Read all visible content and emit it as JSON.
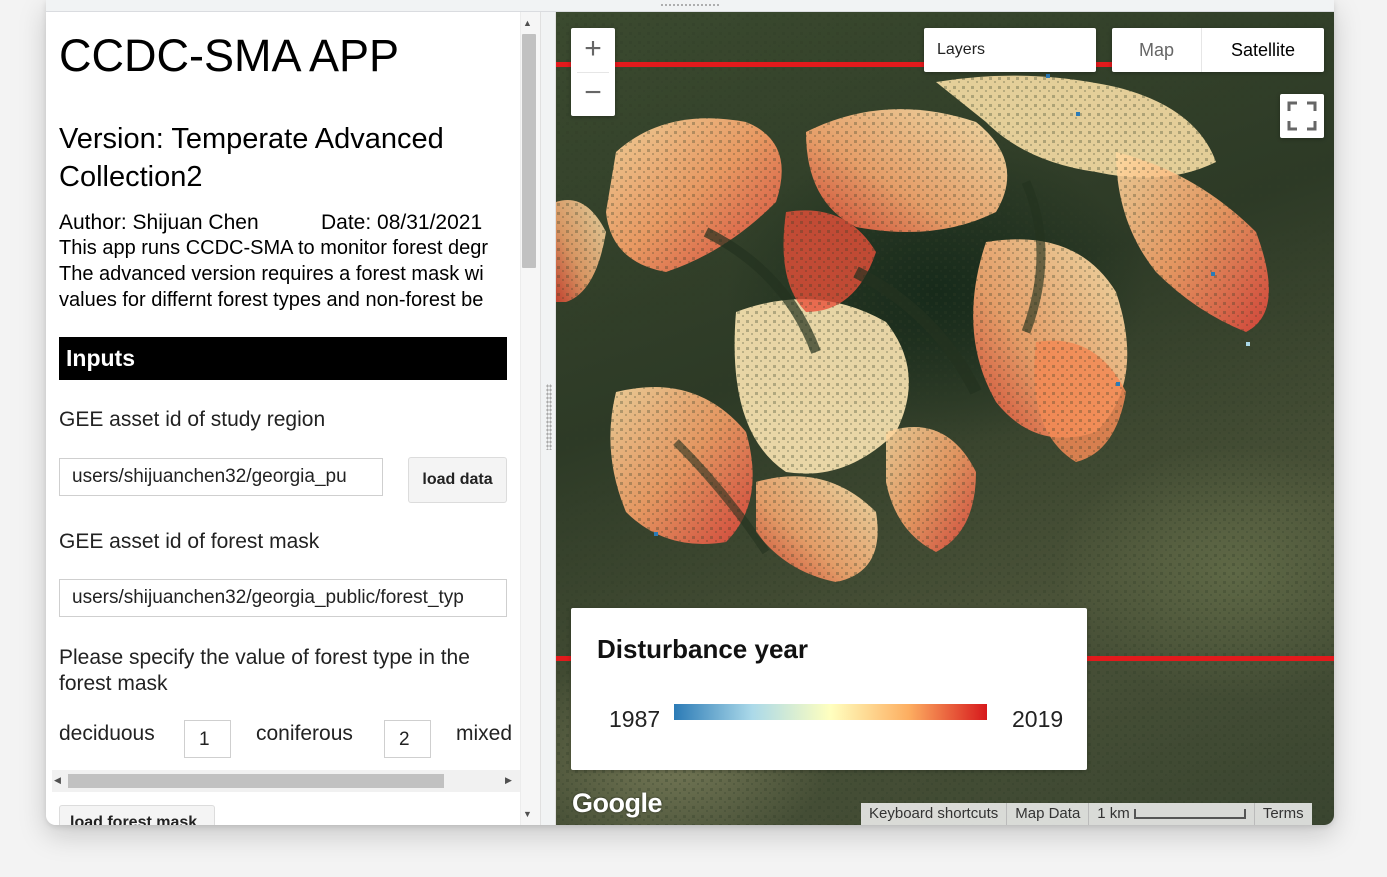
{
  "left_panel": {
    "title": "CCDC-SMA APP",
    "version": "Version: Temperate Advanced Collection2",
    "author": "Author: Shijuan Chen",
    "date": "Date: 08/31/2021",
    "description_lines": [
      "This app runs CCDC-SMA to monitor forest degr",
      "The advanced version requires a forest mask wi",
      "values for differnt forest types and non-forest be"
    ],
    "inputs_header": "Inputs",
    "study_region_label": "GEE asset id of study region",
    "study_region_value": "users/shijuanchen32/georgia_pu",
    "load_data_label": "load data",
    "forest_mask_label": "GEE asset id of forest mask",
    "forest_mask_value": "users/shijuanchen32/georgia_public/forest_typ",
    "forest_type_prompt": "Please specify the value of forest type in the forest mask",
    "deciduous_label": "deciduous",
    "deciduous_value": "1",
    "coniferous_label": "coniferous",
    "coniferous_value": "2",
    "mixed_label": "mixed",
    "load_forest_mask_label": "load forest mask"
  },
  "map": {
    "zoom_in": "+",
    "zoom_out": "−",
    "layers_label": "Layers",
    "maptype_map": "Map",
    "maptype_satellite": "Satellite",
    "legend": {
      "title": "Disturbance year",
      "min": "1987",
      "max": "2019",
      "colors": [
        "#2c7bb6",
        "#abd9e9",
        "#ffffbf",
        "#fdae61",
        "#d7191c"
      ]
    },
    "google_logo": "Google",
    "attribution": {
      "keyboard_shortcuts": "Keyboard shortcuts",
      "map_data": "Map Data",
      "scale": "1 km",
      "terms": "Terms"
    }
  }
}
